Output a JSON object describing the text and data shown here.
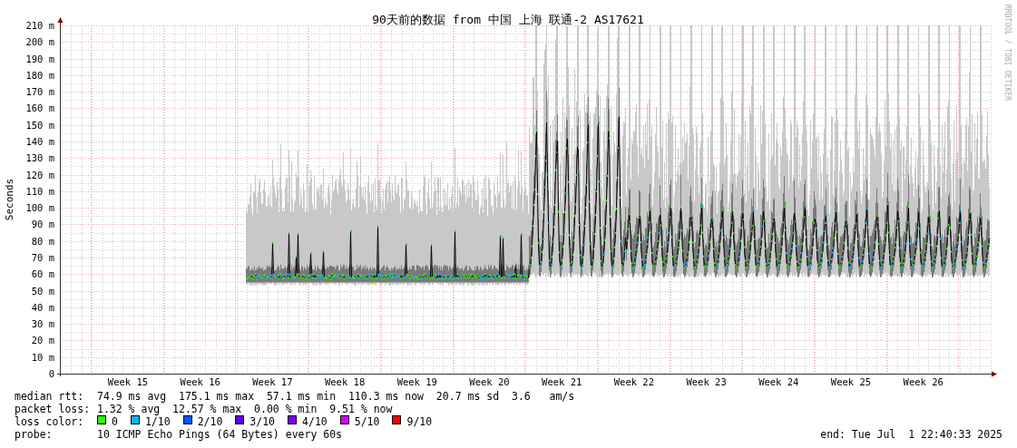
{
  "title": "90天前的数据 from 中国 上海 联通-2 AS17621",
  "ylabel": "Seconds",
  "credit": "RRDTOOL / TOBI OETIKER",
  "y_ticks": [
    "210 m",
    "200 m",
    "190 m",
    "180 m",
    "170 m",
    "160 m",
    "150 m",
    "140 m",
    "130 m",
    "120 m",
    "110 m",
    "100 m",
    "90 m",
    "80 m",
    "70 m",
    "60 m",
    "50 m",
    "40 m",
    "30 m",
    "20 m",
    "10 m",
    "0"
  ],
  "x_ticks": [
    "Week 15",
    "Week 16",
    "Week 17",
    "Week 18",
    "Week 19",
    "Week 20",
    "Week 21",
    "Week 22",
    "Week 23",
    "Week 24",
    "Week 25",
    "Week 26"
  ],
  "stats": [
    {
      "label": "median rtt:",
      "text": "74.9 ms avg  175.1 ms max  57.1 ms min  110.3 ms now  20.7 ms sd  3.6   am/s"
    },
    {
      "label": "packet loss:",
      "text": "1.32 % avg  12.57 % max  0.00 % min  9.51 % now"
    }
  ],
  "loss_label": "loss color:",
  "loss_colors": [
    {
      "label": "0",
      "color": "#26ff00"
    },
    {
      "label": "1/10",
      "color": "#00b8ff"
    },
    {
      "label": "2/10",
      "color": "#0059ff"
    },
    {
      "label": "3/10",
      "color": "#5e00ff"
    },
    {
      "label": "4/10",
      "color": "#7e00ff"
    },
    {
      "label": "5/10",
      "color": "#dd00ff"
    },
    {
      "label": "9/10",
      "color": "#ff0000"
    }
  ],
  "probe": {
    "label": "probe:",
    "text": "10 ICMP Echo Pings (64 Bytes) every 60s"
  },
  "end": "end: Tue Jul  1 22:40:33 2025"
}
